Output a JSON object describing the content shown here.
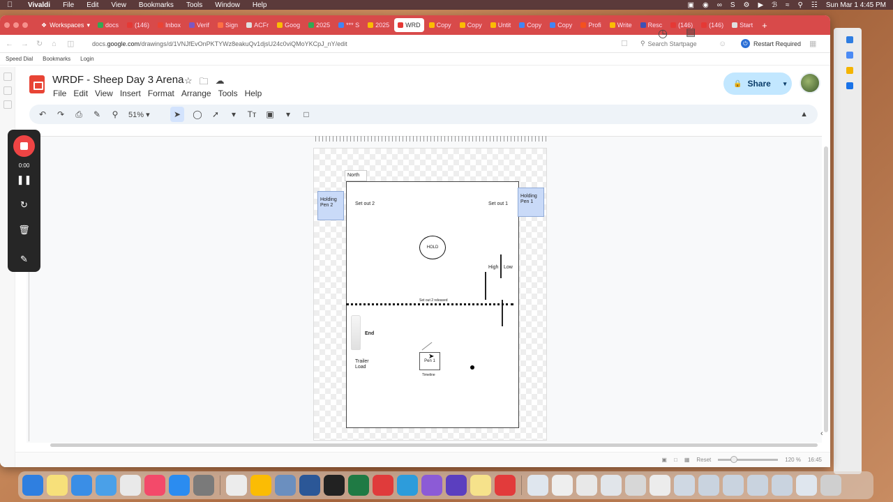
{
  "menubar": {
    "app": "Vivaldi",
    "items": [
      "File",
      "Edit",
      "View",
      "Bookmarks",
      "Tools",
      "Window",
      "Help"
    ],
    "clock": "Sun Mar 1  4:45 PM"
  },
  "tabs": {
    "workspaces": "Workspaces",
    "items": [
      {
        "label": "docs",
        "color": "#34a853"
      },
      {
        "label": "(146)",
        "color": "#e53935"
      },
      {
        "label": "Inbox",
        "color": "#ea4335"
      },
      {
        "label": "Verif",
        "color": "#7e57c2"
      },
      {
        "label": "Sign",
        "color": "#ff7043"
      },
      {
        "label": "ACFr",
        "color": "#e0e0e0"
      },
      {
        "label": "Goog",
        "color": "#fbbc04"
      },
      {
        "label": "2025",
        "color": "#34a853"
      },
      {
        "label": "*** S",
        "color": "#4285f4"
      },
      {
        "label": "2025",
        "color": "#fbbc04"
      },
      {
        "label": "WRD",
        "color": "#e53935",
        "active": true
      },
      {
        "label": "Copy",
        "color": "#fbbc04"
      },
      {
        "label": "Copy",
        "color": "#fbbc04"
      },
      {
        "label": "Untit",
        "color": "#fbbc04"
      },
      {
        "label": "Copy",
        "color": "#4285f4"
      },
      {
        "label": "Copy",
        "color": "#4285f4"
      },
      {
        "label": "Profi",
        "color": "#f4511e"
      },
      {
        "label": "Write",
        "color": "#fbbc04"
      },
      {
        "label": "Resc",
        "color": "#3f51b5"
      },
      {
        "label": "(146)",
        "color": "#e53935"
      },
      {
        "label": "(146)",
        "color": "#e53935"
      },
      {
        "label": "Start",
        "color": "#e0e0e0"
      }
    ]
  },
  "address": {
    "url_pre": "docs.",
    "url_host": "google.com",
    "url_rest": "/drawings/d/1VNJfEvOnPKTYWz8eakuQv1djsU24c0viQMoYKCpJ_nY/edit",
    "search_placeholder": "Search Startpage",
    "restart": "Restart Required"
  },
  "bookmarks": [
    "Speed Dial",
    "Bookmarks",
    "Login"
  ],
  "doc": {
    "title": "WRDF - Sheep Day 3 Arena",
    "menu": [
      "File",
      "Edit",
      "View",
      "Insert",
      "Format",
      "Arrange",
      "Tools",
      "Help"
    ],
    "share": "Share",
    "zoom": "51%"
  },
  "recorder": {
    "time": "0:00"
  },
  "drawing": {
    "north": "North",
    "pen2": "Holding Pen 2",
    "pen1": "Holding Pen 1",
    "setout2": "Set out 2",
    "setout1": "Set out 1",
    "hold": "HOLD",
    "high": "High",
    "low": "Low",
    "released": "Set out 2 released",
    "end": "End",
    "trailer": "Trailer Load",
    "pen1_small": "Pen 1",
    "timeline": "Timeline"
  },
  "status": {
    "reset": "Reset",
    "zoom": "120 %",
    "time": "16:45"
  }
}
